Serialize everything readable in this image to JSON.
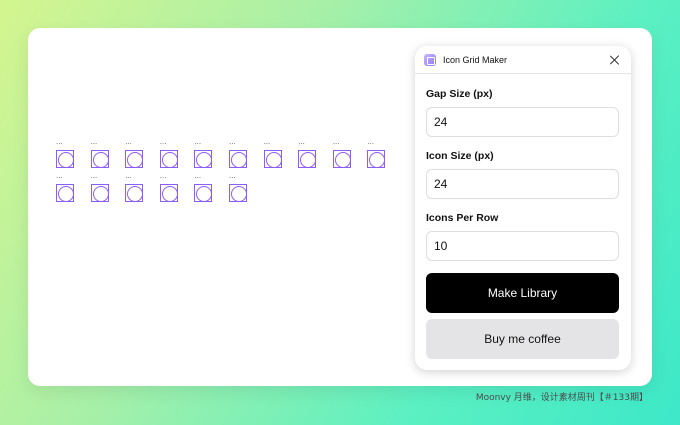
{
  "panel": {
    "title": "Icon Grid Maker",
    "close_icon": "close-icon",
    "app_icon": "icon-grid-maker-icon",
    "fields": [
      {
        "label": "Gap Size (px)",
        "value": "24"
      },
      {
        "label": "Icon Size (px)",
        "value": "24"
      },
      {
        "label": "Icons Per Row",
        "value": "10"
      }
    ],
    "primary_button": "Make Library",
    "secondary_button": "Buy me coffee"
  },
  "canvas": {
    "icon_count": 16,
    "icons_per_row": 10,
    "icon_label": "...",
    "accent_color": "#8b5cf6"
  },
  "footer": {
    "credit": "Moonvy 月维，设计素材周刊【＃133期】"
  }
}
